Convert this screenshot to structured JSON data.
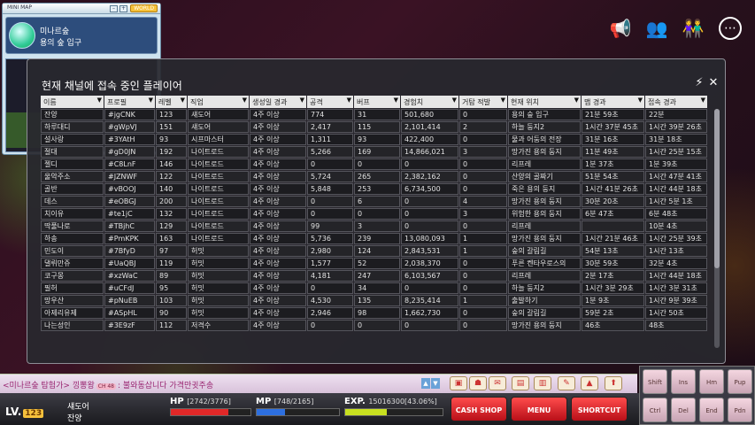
{
  "minimap": {
    "title": "MINI MAP",
    "world_badge": "WORLD",
    "region": "미나르숲",
    "map_name": "용의 숲 입구"
  },
  "top_icons": [
    "megaphone-icon",
    "group-icon",
    "friends-icon",
    "more-icon"
  ],
  "players_window": {
    "title": "현재 채널에 접속 중인 플레이어",
    "columns": [
      "이름",
      "프로필",
      "레벨",
      "직업",
      "생성일 경과",
      "공격",
      "버프",
      "경험치",
      "거탐 적발",
      "현재 위치",
      "맵 경과",
      "접속 경과"
    ],
    "rows": [
      [
        "잔양",
        "#jgCNK",
        "123",
        "섀도어",
        "4주 이상",
        "774",
        "31",
        "501,680",
        "0",
        "용의 숲 입구",
        "21분 59초",
        "22분"
      ],
      [
        "하루대디",
        "#gWpVJ",
        "151",
        "섀도어",
        "4주 이상",
        "2,417",
        "115",
        "2,101,414",
        "2",
        "하늘 둥지2",
        "1시간 37분 45초",
        "1시간 39분 26초"
      ],
      [
        "설사랑",
        "#3YAtH",
        "93",
        "시프마스터",
        "4주 이상",
        "1,311",
        "93",
        "422,400",
        "0",
        "물과 어둠의 전장",
        "31분 16초",
        "31분 18초"
      ],
      [
        "절대",
        "#gD0JN",
        "192",
        "나이트로드",
        "4주 이상",
        "5,266",
        "169",
        "14,866,021",
        "3",
        "망가진 용의 둥지",
        "11분 49초",
        "1시간 25분 15초"
      ],
      [
        "젤디",
        "#C8LnF",
        "146",
        "나이트로드",
        "4주 이상",
        "0",
        "0",
        "0",
        "0",
        "리프레",
        "1분 37초",
        "1분 39초"
      ],
      [
        "울악주소",
        "#JZNWF",
        "122",
        "나이트로드",
        "4주 이상",
        "5,724",
        "265",
        "2,382,162",
        "0",
        "산양의 골짜기",
        "51분 54초",
        "1시간 47분 41초"
      ],
      [
        "골반",
        "#vBOOJ",
        "140",
        "나이트로드",
        "4주 이상",
        "5,848",
        "253",
        "6,734,500",
        "0",
        "죽은 용의 둥지",
        "1시간 41분 26초",
        "1시간 44분 18초"
      ],
      [
        "데스",
        "#eOBGJ",
        "200",
        "나이트로드",
        "4주 이상",
        "0",
        "6",
        "0",
        "4",
        "망가진 용의 둥지",
        "30분 20초",
        "1시간 5분 1초"
      ],
      [
        "치이유",
        "#te1jC",
        "132",
        "나이트로드",
        "4주 이상",
        "0",
        "0",
        "0",
        "3",
        "위험한 용의 둥지",
        "6분 47초",
        "6분 48초"
      ],
      [
        "딱풀나로",
        "#TBjhC",
        "129",
        "나이트로드",
        "4주 이상",
        "99",
        "3",
        "0",
        "0",
        "리프레",
        "",
        "10분 4초"
      ],
      [
        "하송",
        "#PmKPK",
        "163",
        "나이트로드",
        "4주 이상",
        "5,736",
        "239",
        "13,080,093",
        "1",
        "망가진 용의 둥지",
        "1시간 21분 46초",
        "1시간 25분 39초"
      ],
      [
        "민도이",
        "#7BfyD",
        "97",
        "허밋",
        "4주 이상",
        "2,980",
        "124",
        "2,843,531",
        "1",
        "숲의 갈림길",
        "54분 13초",
        "1시간 13초"
      ],
      [
        "댈뤼만쥬",
        "#UaQBJ",
        "119",
        "허밋",
        "4주 이상",
        "1,577",
        "52",
        "2,038,370",
        "0",
        "푸른 켄타우로스의",
        "30분 59초",
        "32분 4초"
      ],
      [
        "코구몽",
        "#xzWaC",
        "89",
        "허밋",
        "4주 이상",
        "4,181",
        "247",
        "6,103,567",
        "0",
        "리프레",
        "2분 17초",
        "1시간 44분 18초"
      ],
      [
        "필허",
        "#uCFdJ",
        "95",
        "허밋",
        "4주 이상",
        "0",
        "34",
        "0",
        "0",
        "하늘 둥지2",
        "1시간 3분 29초",
        "1시간 3분 31초"
      ],
      [
        "망우산",
        "#pNuEB",
        "103",
        "허밋",
        "4주 이상",
        "4,530",
        "135",
        "8,235,414",
        "1",
        "출발하기",
        "1분 9초",
        "1시간 9분 39초"
      ],
      [
        "아제리유제",
        "#ASpHL",
        "90",
        "허밋",
        "4주 이상",
        "2,946",
        "98",
        "1,662,730",
        "0",
        "숲의 갈림길",
        "59분 2초",
        "1시간 50초"
      ],
      [
        "나는성인",
        "#3E9zF",
        "112",
        "저격수",
        "4주 이상",
        "0",
        "0",
        "0",
        "0",
        "망가진 용의 둥지",
        "46초",
        "48초"
      ]
    ]
  },
  "chat": {
    "channel": "<미나르숲 탐험가>",
    "name": "낑뽕왕",
    "badge": "CH 48",
    "message": ": 불와동삽니다 가격만귓주송"
  },
  "status": {
    "lv_label": "LV.",
    "level": "123",
    "job": "섀도어",
    "name": "잔양",
    "hp_label": "HP",
    "hp_text": "[2742/3776]",
    "hp_ratio": 0.726,
    "mp_label": "MP",
    "mp_text": "[748/2165]",
    "mp_ratio": 0.345,
    "exp_label": "EXP.",
    "exp_text": "15016300[43.06%]",
    "exp_ratio": 0.4306,
    "cash_shop": "CASH SHOP",
    "menu": "MENU",
    "shortcut": "SHORTCUT"
  },
  "skills": [
    "Shift",
    "Ins",
    "Hm",
    "Pup",
    "Ctrl",
    "Del",
    "End",
    "Pdn"
  ],
  "colors": {
    "hp": "#e02828",
    "mp": "#2d6fe0",
    "exp": "#c8e020",
    "accent": "#f6c13c"
  }
}
